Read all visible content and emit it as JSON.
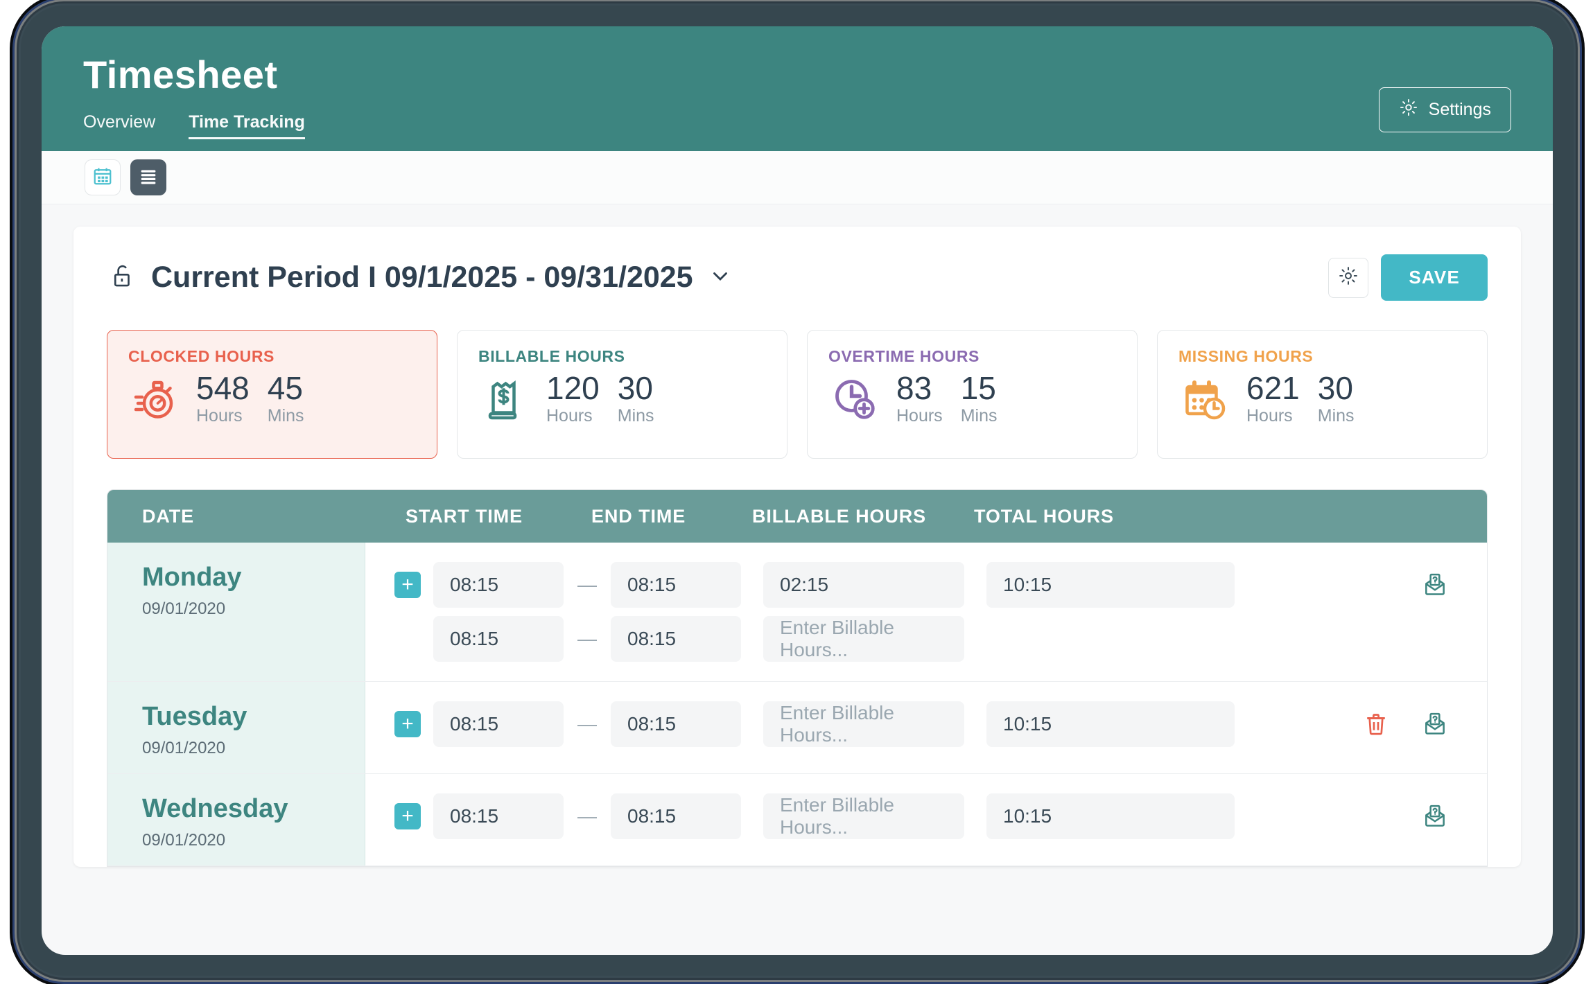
{
  "header": {
    "title": "Timesheet",
    "tabs": [
      {
        "label": "Overview",
        "active": false
      },
      {
        "label": "Time Tracking",
        "active": true
      }
    ],
    "settings_button": "Settings",
    "gear_icon": "gear-icon"
  },
  "toolbar": {
    "calendar_view_icon": "calendar-icon",
    "list_view_icon": "list-icon"
  },
  "period": {
    "lock_icon": "unlock-icon",
    "title": "Current Period I 09/1/2025 - 09/31/2025",
    "chevron_icon": "chevron-down-icon",
    "settings_icon": "gear-icon",
    "save_label": "SAVE"
  },
  "stats": [
    {
      "label": "CLOCKED HOURS",
      "hours": "548",
      "mins": "45",
      "hours_unit": "Hours",
      "mins_unit": "Mins",
      "icon": "stopwatch-icon",
      "color": "#e8614d",
      "highlight": true
    },
    {
      "label": "BILLABLE HOURS",
      "hours": "120",
      "mins": "30",
      "hours_unit": "Hours",
      "mins_unit": "Mins",
      "icon": "receipt-dollar-icon",
      "color": "#3d8580",
      "highlight": false
    },
    {
      "label": "OVERTIME HOURS",
      "hours": "83",
      "mins": "15",
      "hours_unit": "Hours",
      "mins_unit": "Mins",
      "icon": "clock-plus-icon",
      "color": "#8b6bb1",
      "highlight": false
    },
    {
      "label": "MISSING HOURS",
      "hours": "621",
      "mins": "30",
      "hours_unit": "Hours",
      "mins_unit": "Mins",
      "icon": "calendar-clock-icon",
      "color": "#f0a24b",
      "highlight": false
    }
  ],
  "table": {
    "columns": [
      "DATE",
      "START TIME",
      "END TIME",
      "BILLABLE HOURS",
      "TOTAL HOURS"
    ],
    "billable_placeholder": "Enter Billable Hours...",
    "add_label": "+",
    "dash": "—",
    "rows": [
      {
        "day": "Monday",
        "date": "09/01/2020",
        "entries": [
          {
            "start": "08:15",
            "end": "08:15",
            "billable": "02:15",
            "billable_is_placeholder": false
          },
          {
            "start": "08:15",
            "end": "08:15",
            "billable": "Enter Billable Hours...",
            "billable_is_placeholder": true
          }
        ],
        "total": "10:15",
        "has_delete": false,
        "delete_icon": "trash-icon",
        "query_icon": "envelope-question-icon"
      },
      {
        "day": "Tuesday",
        "date": "09/01/2020",
        "entries": [
          {
            "start": "08:15",
            "end": "08:15",
            "billable": "Enter Billable Hours...",
            "billable_is_placeholder": true
          }
        ],
        "total": "10:15",
        "has_delete": true,
        "delete_icon": "trash-icon",
        "query_icon": "envelope-question-icon"
      },
      {
        "day": "Wednesday",
        "date": "09/01/2020",
        "entries": [
          {
            "start": "08:15",
            "end": "08:15",
            "billable": "Enter Billable Hours...",
            "billable_is_placeholder": true
          }
        ],
        "total": "10:15",
        "has_delete": false,
        "delete_icon": "trash-icon",
        "query_icon": "envelope-question-icon"
      }
    ]
  }
}
